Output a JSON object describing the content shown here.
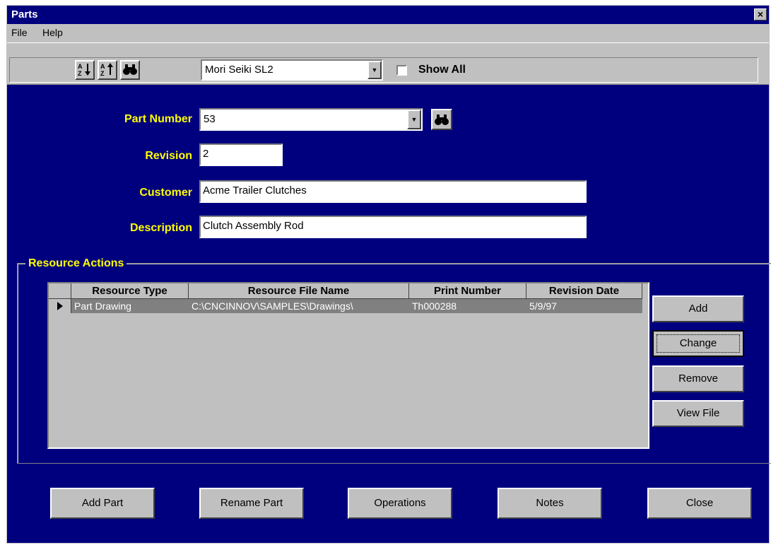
{
  "window": {
    "title": "Parts",
    "close_glyph": "×"
  },
  "menu": {
    "file": "File",
    "help": "Help"
  },
  "toolbar": {
    "sort_asc_icon": "sort-ascending-icon",
    "sort_desc_icon": "sort-descending-icon",
    "find_icon": "binoculars-icon",
    "machine_value": "Mori Seiki SL2",
    "show_all_label": "Show All",
    "show_all_checked": false
  },
  "form": {
    "part_number_label": "Part Number",
    "part_number_value": "53",
    "revision_label": "Revision",
    "revision_value": "2",
    "customer_label": "Customer",
    "customer_value": "Acme Trailer Clutches",
    "description_label": "Description",
    "description_value": "Clutch Assembly Rod"
  },
  "resources": {
    "group_title": "Resource Actions",
    "columns": [
      "Resource Type",
      "Resource File Name",
      "Print Number",
      "Revision Date"
    ],
    "rows": [
      {
        "type": "Part Drawing",
        "file": "C:\\CNCINNOV\\SAMPLES\\Drawings\\",
        "print": "Th000288",
        "date": "5/9/97"
      }
    ],
    "buttons": {
      "add": "Add",
      "change": "Change",
      "remove": "Remove",
      "view": "View File"
    }
  },
  "footer": {
    "add_part": "Add Part",
    "rename_part": "Rename Part",
    "operations": "Operations",
    "notes": "Notes",
    "close": "Close"
  },
  "colors": {
    "window_bg": "#00007f",
    "label": "#ffff00",
    "chrome": "#c0c0c0",
    "selected_row": "#808080"
  }
}
